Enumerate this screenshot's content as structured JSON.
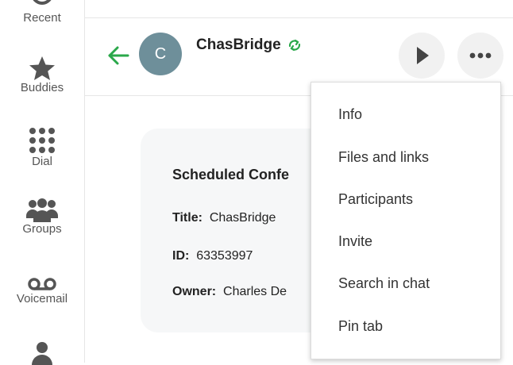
{
  "rail": {
    "items": [
      {
        "label": "Recent",
        "icon": "clock-icon"
      },
      {
        "label": "Buddies",
        "icon": "star-icon"
      },
      {
        "label": "Dial",
        "icon": "dialpad-icon"
      },
      {
        "label": "Groups",
        "icon": "group-icon"
      },
      {
        "label": "Voicemail",
        "icon": "voicemail-icon"
      },
      {
        "label": "",
        "icon": "person-icon"
      }
    ]
  },
  "header": {
    "avatar_letter": "C",
    "chat_name": "ChasBridge",
    "sync_icon": "sync-icon",
    "accent_color": "#2aa84a",
    "avatar_color": "#6e8f9a"
  },
  "card": {
    "title": "Scheduled Confe",
    "fields": [
      {
        "key": "Title:",
        "value": "ChasBridge"
      },
      {
        "key": "ID:",
        "value": "63353997"
      },
      {
        "key": "Owner:",
        "value": "Charles De"
      }
    ]
  },
  "menu": {
    "items": [
      "Info",
      "Files and links",
      "Participants",
      "Invite",
      "Search in chat",
      "Pin tab"
    ]
  }
}
